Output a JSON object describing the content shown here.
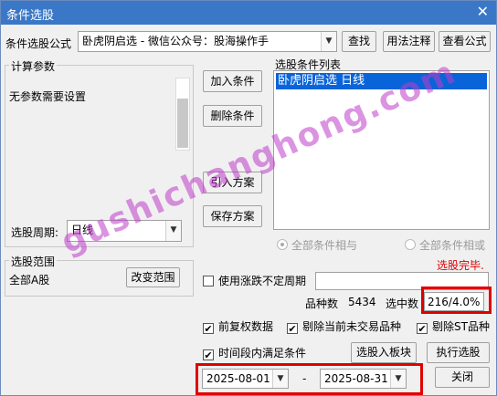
{
  "window": {
    "title": "条件选股",
    "close_glyph": "✕"
  },
  "formula": {
    "label": "条件选股公式",
    "selected": "卧虎阴启选  -  微信公众号：股海操作手",
    "find_label": "查找",
    "usage_label": "用法注释",
    "view_label": "查看公式"
  },
  "params": {
    "group_label": "计算参数",
    "note": "无参数需要设置",
    "period_label": "选股周期:",
    "period_value": "日线"
  },
  "buttons": {
    "add": "加入条件",
    "delete": "删除条件",
    "import": "引入方案",
    "save": "保存方案",
    "change_range": "改变范围",
    "to_block": "选股入板块",
    "execute": "执行选股",
    "close": "关闭"
  },
  "conditions": {
    "group_label": "选股条件列表",
    "items": [
      "卧虎阴启选  日线"
    ],
    "radio_and": "全部条件相与",
    "radio_or": "全部条件相或",
    "status": "选股完毕."
  },
  "scope": {
    "group_label": "选股范围",
    "value": "全部A股"
  },
  "options": {
    "use_period_label": "使用涨跌不定周期",
    "count_label": "品种数",
    "count_value": "5434",
    "hit_label": "选中数",
    "hit_value": "216/4.0%",
    "pre_adjust": "前复权数据",
    "exclude_untraded": "剔除当前未交易品种",
    "exclude_st": "剔除ST品种",
    "time_condition": "时间段内满足条件",
    "check_mark": "✔"
  },
  "dates": {
    "start": "2025-08-01",
    "separator": "-",
    "end": "2025-08-31"
  },
  "watermark": "gushichanghong.com",
  "colors": {
    "titlebar": "#3a78c7",
    "selection": "#0a64d9",
    "status_red": "#e00000",
    "highlight_box": "#e00000"
  }
}
